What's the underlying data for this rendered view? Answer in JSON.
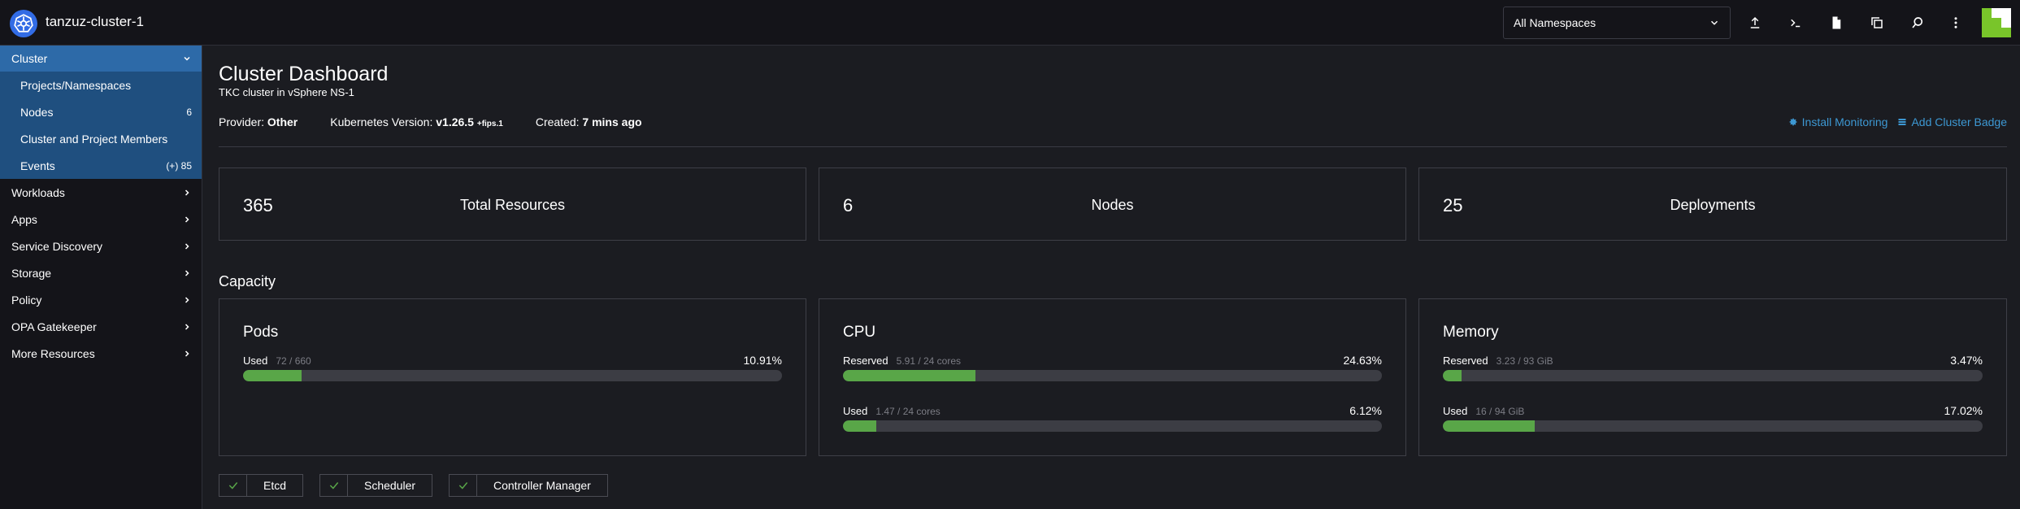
{
  "header": {
    "cluster_name": "tanzuz-cluster-1",
    "namespace_select": "All Namespaces",
    "icons": [
      "upload-icon",
      "terminal-icon",
      "file-icon",
      "copy-icon",
      "search-icon",
      "more-vertical-icon"
    ]
  },
  "sidebar": {
    "cluster_label": "Cluster",
    "sub_items": [
      {
        "label": "Projects/Namespaces",
        "count": ""
      },
      {
        "label": "Nodes",
        "count": "6"
      },
      {
        "label": "Cluster and Project Members",
        "count": ""
      },
      {
        "label": "Events",
        "count": "(+) 85"
      }
    ],
    "items": [
      {
        "label": "Workloads"
      },
      {
        "label": "Apps"
      },
      {
        "label": "Service Discovery"
      },
      {
        "label": "Storage"
      },
      {
        "label": "Policy"
      },
      {
        "label": "OPA Gatekeeper"
      },
      {
        "label": "More Resources"
      }
    ]
  },
  "page": {
    "title": "Cluster Dashboard",
    "subtitle": "TKC cluster in vSphere NS-1",
    "provider_label": "Provider:",
    "provider_value": "Other",
    "k8s_label": "Kubernetes Version:",
    "k8s_value": "v1.26.5",
    "k8s_suffix": "+fips.1",
    "created_label": "Created:",
    "created_value": "7 mins ago",
    "install_monitoring": "Install Monitoring",
    "add_badge": "Add Cluster Badge"
  },
  "stats": [
    {
      "value": "365",
      "label": "Total Resources"
    },
    {
      "value": "6",
      "label": "Nodes"
    },
    {
      "value": "25",
      "label": "Deployments"
    }
  ],
  "capacity": {
    "title": "Capacity",
    "pods": {
      "title": "Pods",
      "used_label": "Used",
      "used_detail": "72 / 660",
      "used_pct": "10.91%",
      "used_fraction": 0.1091
    },
    "cpu": {
      "title": "CPU",
      "reserved_label": "Reserved",
      "reserved_detail": "5.91 / 24 cores",
      "reserved_pct": "24.63%",
      "reserved_fraction": 0.2463,
      "used_label": "Used",
      "used_detail": "1.47 / 24 cores",
      "used_pct": "6.12%",
      "used_fraction": 0.0612
    },
    "memory": {
      "title": "Memory",
      "reserved_label": "Reserved",
      "reserved_detail": "3.23 / 93 GiB",
      "reserved_pct": "3.47%",
      "reserved_fraction": 0.0347,
      "used_label": "Used",
      "used_detail": "16 / 94 GiB",
      "used_pct": "17.02%",
      "used_fraction": 0.1702
    }
  },
  "components": [
    {
      "label": "Etcd"
    },
    {
      "label": "Scheduler"
    },
    {
      "label": "Controller Manager"
    }
  ],
  "colors": {
    "accent": "#2d6aa8",
    "link": "#3d98d3",
    "ok": "#59a648"
  }
}
